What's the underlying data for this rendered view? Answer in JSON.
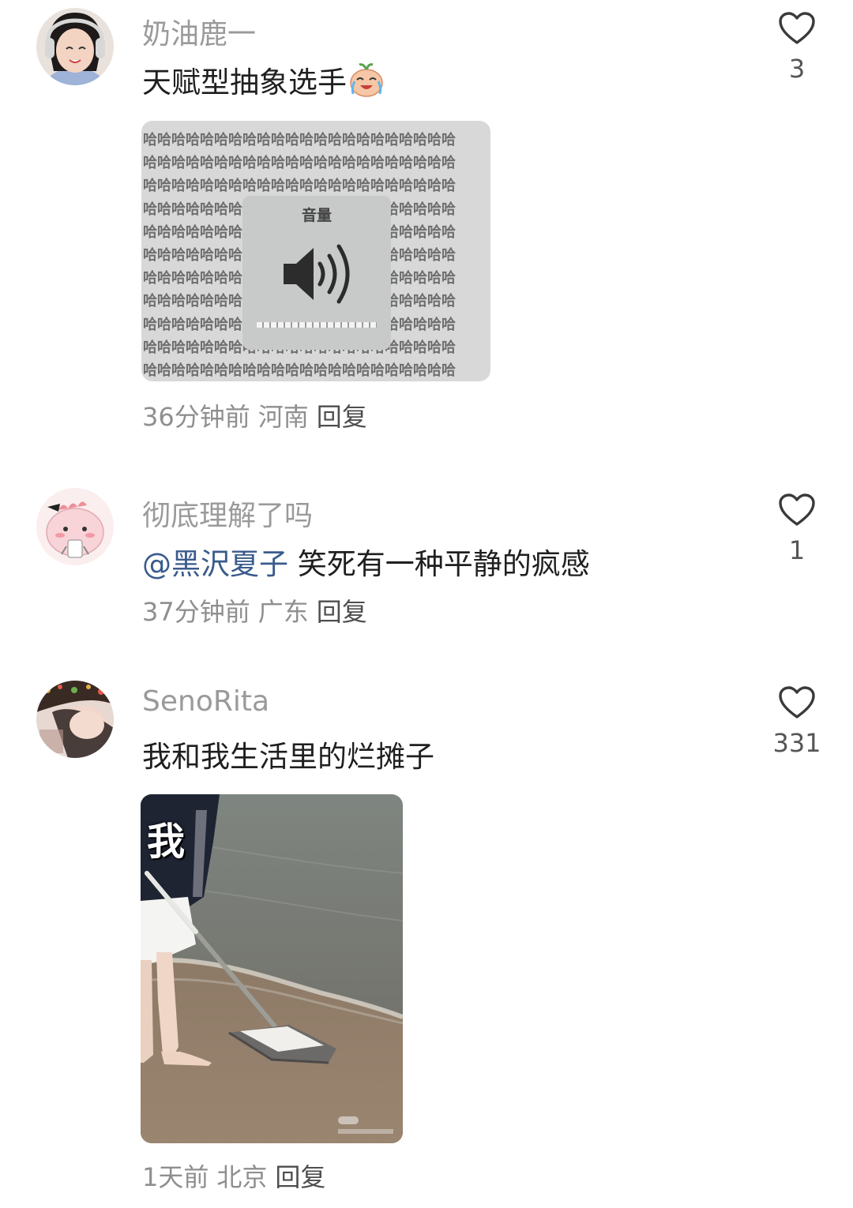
{
  "comments": [
    {
      "username": "奶油鹿一",
      "text": "天赋型抽象选手",
      "emoji": "crying-laughing-face-icon",
      "image": {
        "title": "音量",
        "pattern_text": "哈"
      },
      "time": "36分钟前",
      "location": "河南",
      "reply": "回复",
      "likes": "3"
    },
    {
      "username": "彻底理解了吗",
      "mention": "@黑沢夏子",
      "text": "笑死有一种平静的疯感",
      "time": "37分钟前",
      "location": "广东",
      "reply": "回复",
      "likes": "1"
    },
    {
      "username": "SenoRita",
      "text": "我和我生活里的烂摊子",
      "image": {
        "overlay_text": "我"
      },
      "time": "1天前",
      "location": "北京",
      "reply": "回复",
      "likes": "331"
    }
  ],
  "colors": {
    "username": "#9a9a9a",
    "mention": "#3a5b8c",
    "meta": "#8f8f8f"
  }
}
